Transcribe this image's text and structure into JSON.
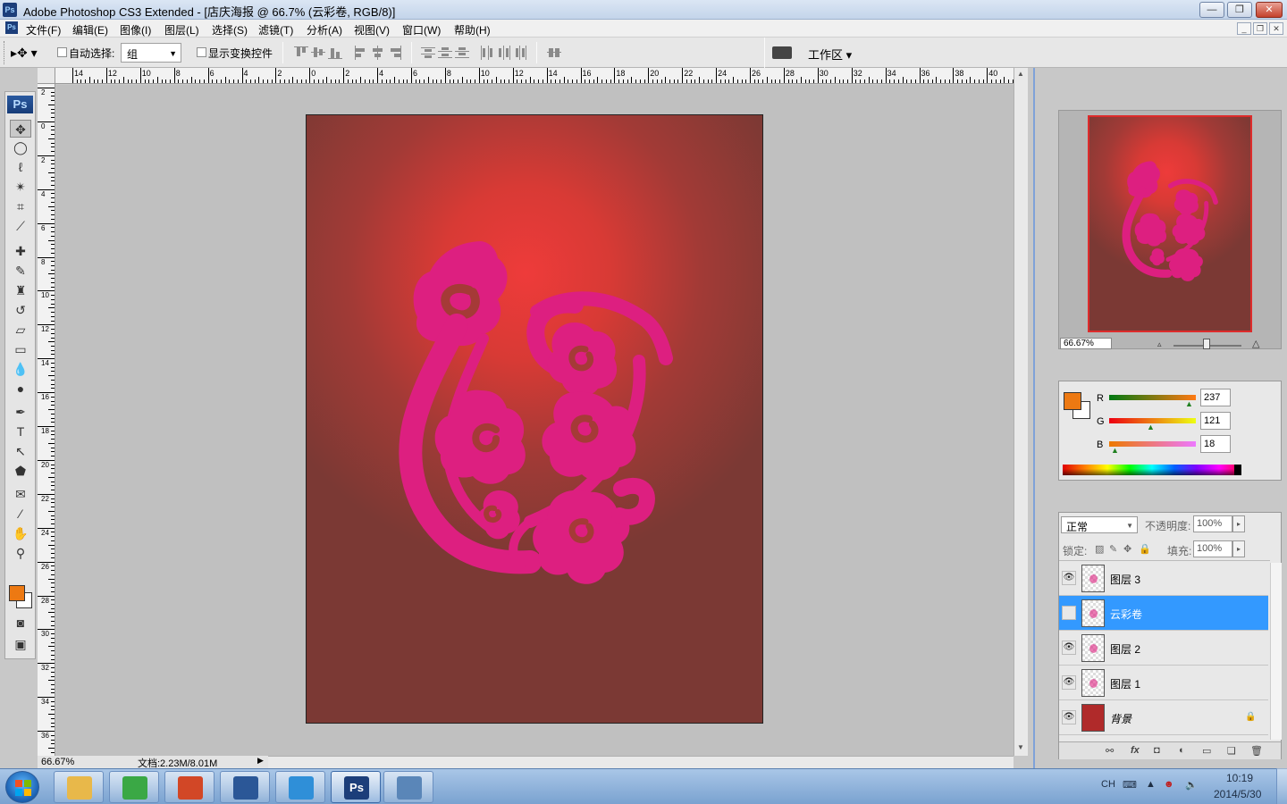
{
  "window": {
    "title": "Adobe Photoshop CS3 Extended - [店庆海报 @ 66.7% (云彩卷, RGB/8)]",
    "app_icon": "Ps",
    "minimize_icon": "minimize-icon",
    "maximize_icon": "restore-icon",
    "close_icon": "close-icon",
    "min_glyph": "—",
    "max_glyph": "❐",
    "close_glyph": "✕"
  },
  "menu": {
    "items": [
      "文件(F)",
      "编辑(E)",
      "图像(I)",
      "图层(L)",
      "选择(S)",
      "滤镜(T)",
      "分析(A)",
      "视图(V)",
      "窗口(W)",
      "帮助(H)"
    ],
    "doc_min": "_",
    "doc_restore": "❐",
    "doc_close": "✕"
  },
  "options": {
    "auto_select_label": "自动选择:",
    "auto_select_value": "组",
    "show_transform_label": "显示变换控件",
    "workspace_label": "工作区 ▾",
    "move_tool_glyph": "▸✥ ▾"
  },
  "tools": [
    {
      "icon": "move-tool-icon",
      "glyph": "✥",
      "active": true
    },
    {
      "icon": "marquee-tool-icon",
      "glyph": "◯"
    },
    {
      "icon": "lasso-tool-icon",
      "glyph": "ℓ"
    },
    {
      "icon": "magic-wand-tool-icon",
      "glyph": "✴"
    },
    {
      "icon": "crop-tool-icon",
      "glyph": "⌗"
    },
    {
      "icon": "slice-tool-icon",
      "glyph": "⟋"
    },
    {
      "icon": "healing-brush-tool-icon",
      "glyph": "✚"
    },
    {
      "icon": "brush-tool-icon",
      "glyph": "✎"
    },
    {
      "icon": "clone-stamp-tool-icon",
      "glyph": "♜"
    },
    {
      "icon": "history-brush-tool-icon",
      "glyph": "↺"
    },
    {
      "icon": "eraser-tool-icon",
      "glyph": "▱"
    },
    {
      "icon": "gradient-tool-icon",
      "glyph": "▭"
    },
    {
      "icon": "blur-tool-icon",
      "glyph": "💧"
    },
    {
      "icon": "dodge-tool-icon",
      "glyph": "●"
    },
    {
      "icon": "pen-tool-icon",
      "glyph": "✒"
    },
    {
      "icon": "type-tool-icon",
      "glyph": "T"
    },
    {
      "icon": "path-selection-tool-icon",
      "glyph": "↖"
    },
    {
      "icon": "shape-tool-icon",
      "glyph": "⬟"
    },
    {
      "icon": "notes-tool-icon",
      "glyph": "✉"
    },
    {
      "icon": "eyedropper-tool-icon",
      "glyph": "⁄"
    },
    {
      "icon": "hand-tool-icon",
      "glyph": "✋"
    },
    {
      "icon": "zoom-tool-icon",
      "glyph": "⚲"
    },
    {
      "icon": "quick-mask-icon",
      "glyph": "◙"
    },
    {
      "icon": "screen-mode-icon",
      "glyph": "▣"
    }
  ],
  "colors": {
    "foreground": "#ed7912",
    "background": "#ffffff",
    "shape": "#dd1f80",
    "canvas_center": "#ee3b3a",
    "canvas_edge": "#7b3934",
    "selection": "#3399ff"
  },
  "rulers": {
    "top_labels": [
      "14",
      "12",
      "10",
      "8",
      "6",
      "4",
      "2",
      "0",
      "2",
      "4",
      "6",
      "8",
      "10",
      "12",
      "14",
      "16",
      "18",
      "20",
      "22",
      "24",
      "26",
      "28",
      "30",
      "32",
      "34",
      "36",
      "38",
      "40"
    ],
    "left_labels": [
      "2",
      "0",
      "2",
      "4",
      "6",
      "8",
      "10",
      "12",
      "14",
      "16",
      "18",
      "20",
      "22",
      "24",
      "26",
      "28",
      "30",
      "32",
      "34",
      "36"
    ]
  },
  "status": {
    "zoom": "66.67%",
    "doc_info": "文档:2.23M/8.01M",
    "play_glyph": "▶"
  },
  "navigator": {
    "zoom": "66.67%"
  },
  "color_panel": {
    "channels": [
      {
        "label": "R",
        "value": "237"
      },
      {
        "label": "G",
        "value": "121"
      },
      {
        "label": "B",
        "value": "18"
      }
    ]
  },
  "layers_panel": {
    "blend_mode": "正常",
    "opacity_label": "不透明度:",
    "opacity_value": "100%",
    "lock_label": "锁定:",
    "fill_label": "填充:",
    "fill_value": "100%",
    "arrow_glyph": "▸",
    "layers": [
      {
        "name": "图层 3",
        "visible": true,
        "selected": false
      },
      {
        "name": "云彩卷",
        "visible": false,
        "selected": true
      },
      {
        "name": "图层 2",
        "visible": true,
        "selected": false
      },
      {
        "name": "图层 1",
        "visible": true,
        "selected": false
      },
      {
        "name": "背景",
        "visible": true,
        "selected": false,
        "locked": true
      }
    ],
    "footer_icons": [
      "link-layers-icon",
      "layer-style-icon",
      "layer-mask-icon",
      "adjustment-layer-icon",
      "new-group-icon",
      "new-layer-icon",
      "delete-layer-icon"
    ]
  },
  "taskbar": {
    "apps": [
      {
        "icon": "file-explorer-icon",
        "color": "#e8b84a"
      },
      {
        "icon": "browser-icon",
        "color": "#3aa845"
      },
      {
        "icon": "powerpoint-icon",
        "color": "#d24726"
      },
      {
        "icon": "word-icon",
        "color": "#2b5797"
      },
      {
        "icon": "tool-app-icon",
        "color": "#2f8fd8"
      },
      {
        "icon": "photoshop-icon",
        "color": "#1c3e7a",
        "active": true,
        "label": "Ps"
      },
      {
        "icon": "image-viewer-icon",
        "color": "#5a86b8"
      }
    ],
    "tray_lang": "CH",
    "clock_time": "10:19",
    "clock_date": "2014/5/30"
  }
}
